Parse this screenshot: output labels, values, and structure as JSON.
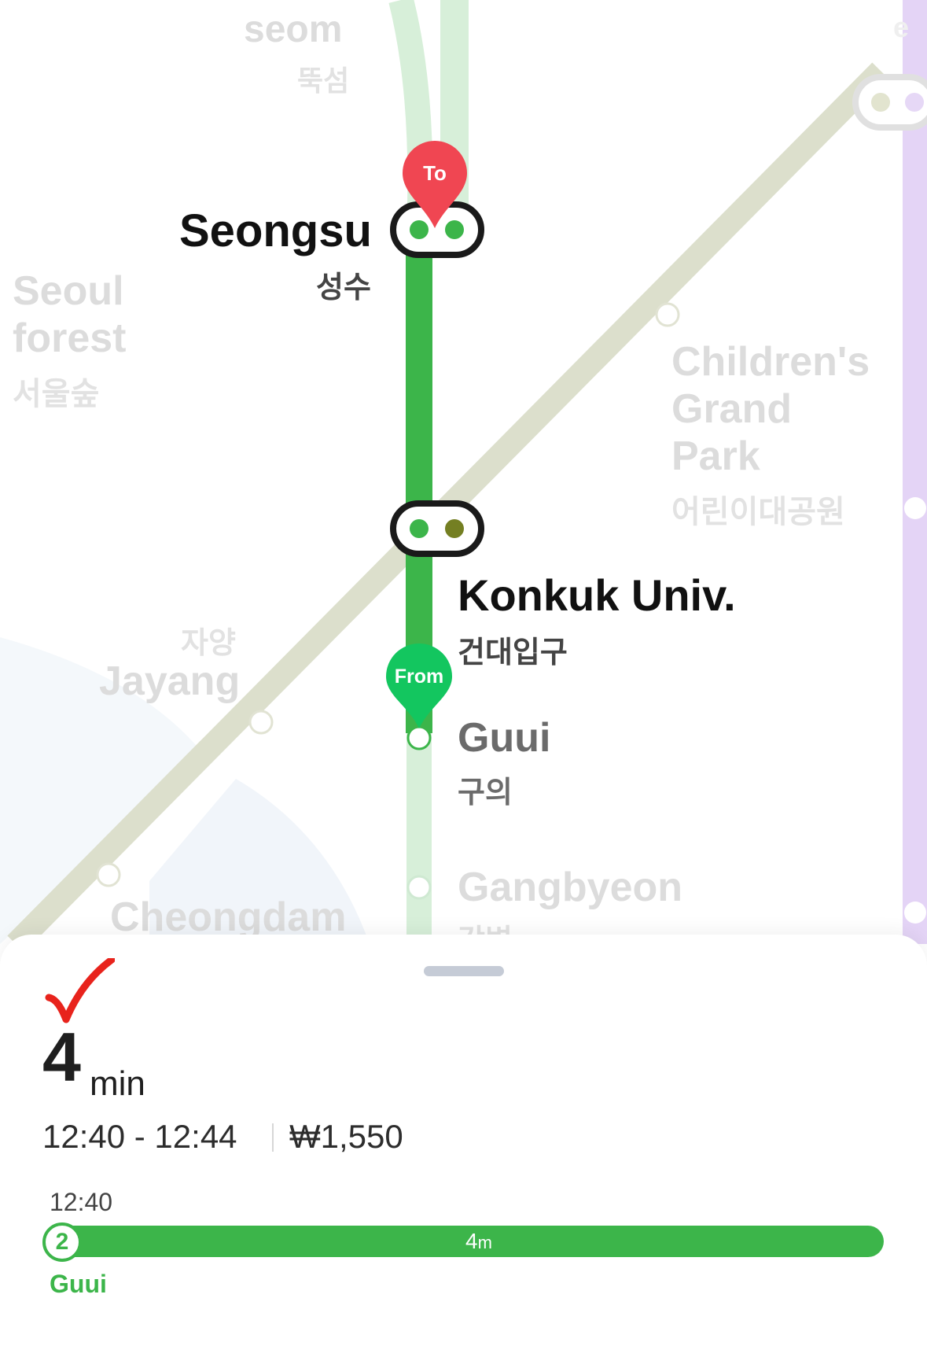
{
  "map": {
    "stations": {
      "ttukseom": {
        "en": "seom",
        "kr": "뚝섬"
      },
      "seoul_forest": {
        "en_line1": "Seoul",
        "en_line2": "forest",
        "kr": "서울숲"
      },
      "seongsu": {
        "en": "Seongsu",
        "kr": "성수"
      },
      "childrens_park": {
        "en_line1": "Children's",
        "en_line2": "Grand",
        "en_line3": "Park",
        "kr": "어린이대공원"
      },
      "konkuk": {
        "en": "Konkuk Univ.",
        "kr": "건대입구"
      },
      "jayang": {
        "en": "Jayang",
        "kr": "자양"
      },
      "guui": {
        "en": "Guui",
        "kr": "구의"
      },
      "gangbyeon": {
        "en": "Gangbyeon",
        "kr": "강변"
      },
      "cheongdam": {
        "en": "Cheongdam"
      },
      "top_right_partial": {
        "en": "e"
      }
    },
    "pins": {
      "to": "To",
      "from": "From"
    },
    "colors": {
      "line2": "#3cb54a",
      "line7": "#d8dcc6",
      "line2_light": "#d7efd9",
      "destination_pin": "#f04652",
      "origin_pin": "#13c65f",
      "purple_line": "#e4d4f6"
    }
  },
  "sheet": {
    "check_icon": "red-checkmark",
    "duration_value": "4",
    "duration_unit": "min",
    "time_range": "12:40 - 12:44",
    "fare": "₩1,550",
    "departure_time": "12:40",
    "line_number": "2",
    "segment_duration": "4",
    "segment_unit": "m",
    "origin_station": "Guui"
  }
}
